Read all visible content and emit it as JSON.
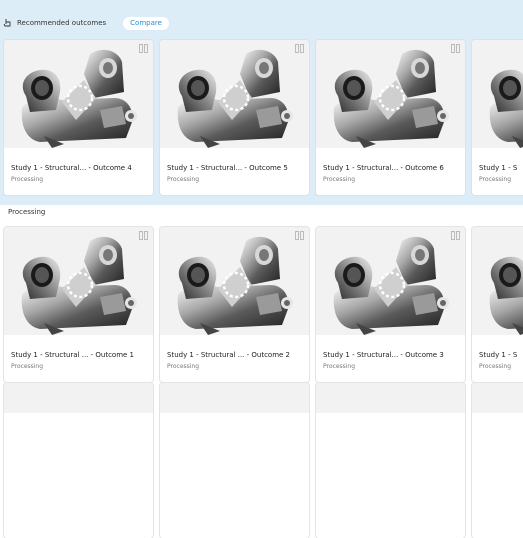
{
  "recommended": {
    "title": "Recommended outcomes",
    "compare_label": "Compare",
    "cards": [
      {
        "title": "Study 1 - Structural... - Outcome 4",
        "status": "Processing"
      },
      {
        "title": "Study 1 - Structural... - Outcome 5",
        "status": "Processing"
      },
      {
        "title": "Study 1 - Structural... - Outcome 6",
        "status": "Processing"
      },
      {
        "title": "Study 1 - S",
        "status": "Processing"
      }
    ]
  },
  "processing": {
    "title": "Processing",
    "cards": [
      {
        "title": "Study 1 - Structural ... - Outcome 1",
        "status": "Processing"
      },
      {
        "title": "Study 1 - Structural ... - Outcome 2",
        "status": "Processing"
      },
      {
        "title": "Study 1 - Structural... - Outcome 3",
        "status": "Processing"
      },
      {
        "title": "Study 1 - S",
        "status": "Processing"
      }
    ]
  },
  "colors": {
    "band": "#dcedf7",
    "accent": "#2b8ed0",
    "thumb_bg": "#f2f2f2"
  },
  "icons": {
    "header": "hand-pointer-icon",
    "card_compare": "compare-icon"
  }
}
